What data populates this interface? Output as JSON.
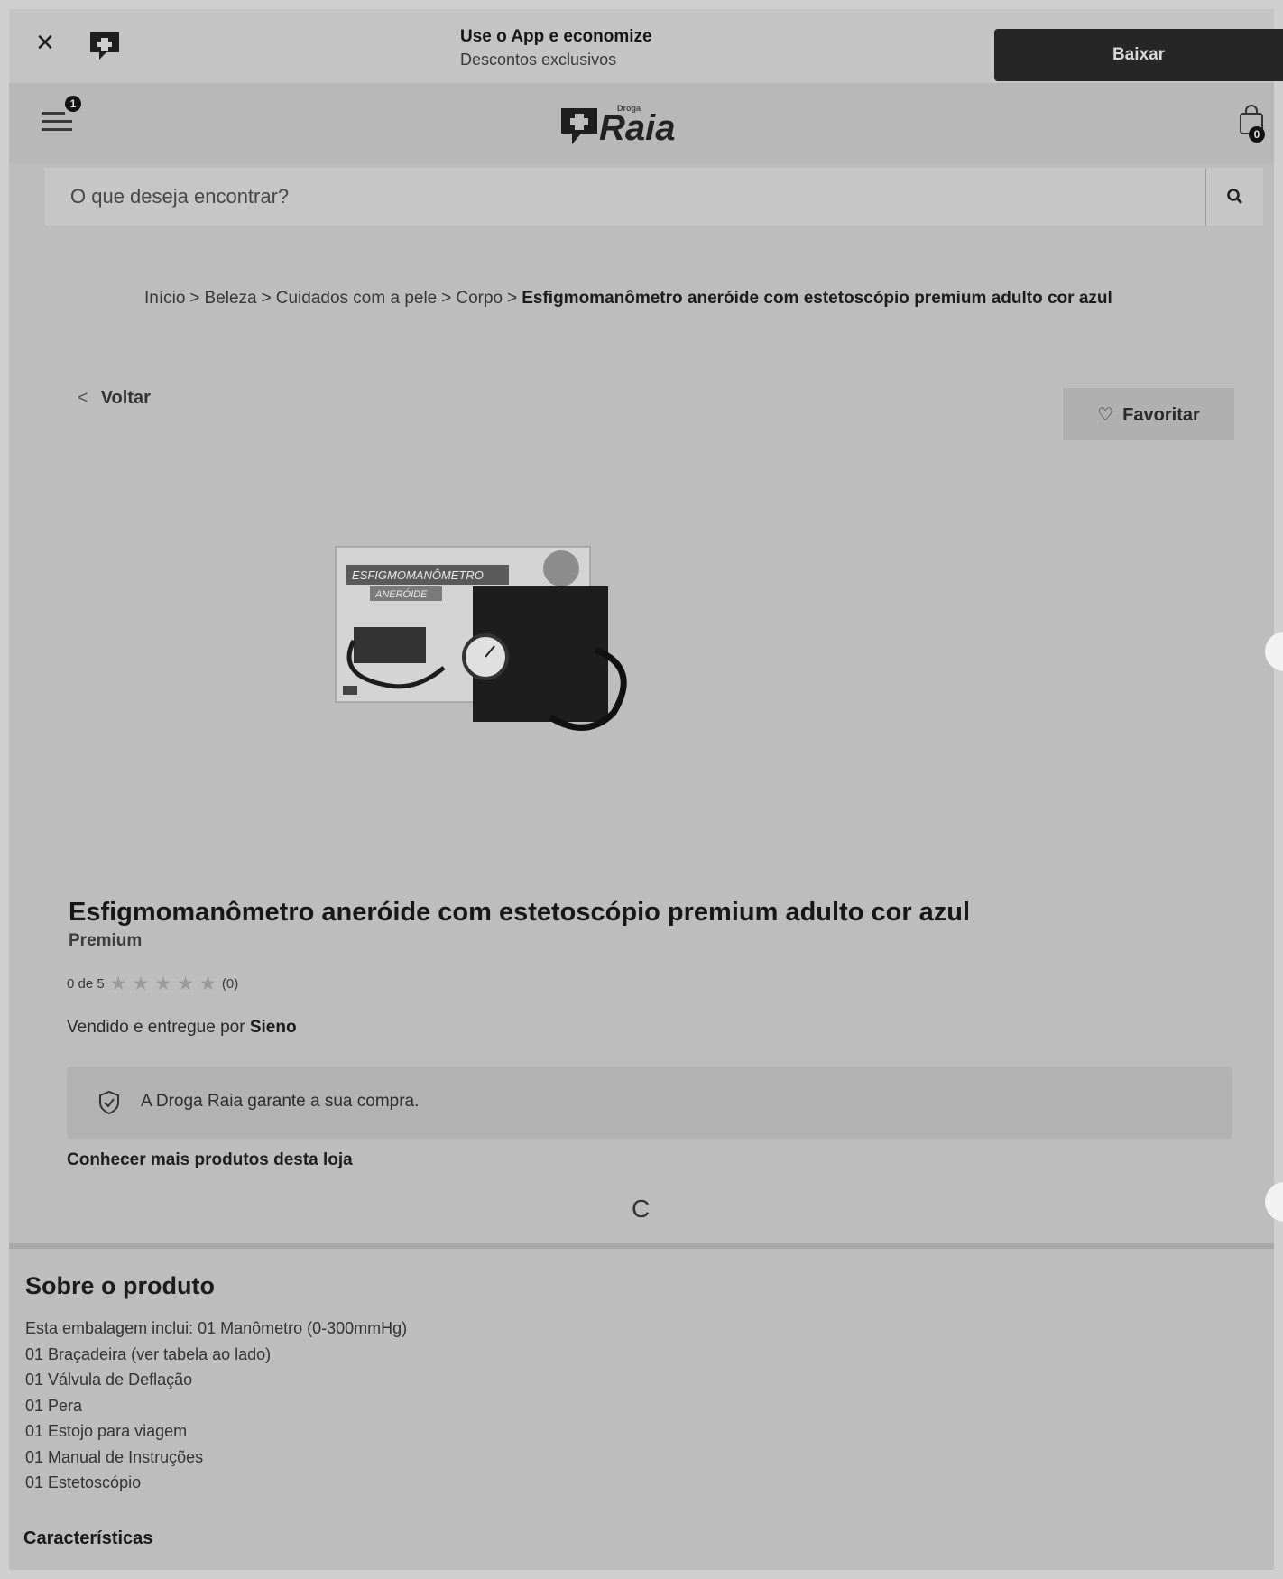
{
  "banner": {
    "title": "Use o App e economize",
    "subtitle": "Descontos exclusivos",
    "download_label": "Baixar"
  },
  "header": {
    "menu_badge": "1",
    "logo_small": "Droga",
    "logo_word": "Raia",
    "cart_count": "0"
  },
  "search": {
    "placeholder": "O que deseja encontrar?"
  },
  "breadcrumb": {
    "items": [
      "Início",
      "Beleza",
      "Cuidados com a pele",
      "Corpo"
    ],
    "separator": ">",
    "current": "Esfigmomanômetro aneróide com estetoscópio premium adulto cor azul"
  },
  "nav": {
    "back_label": "Voltar",
    "favorite_label": "Favoritar"
  },
  "product": {
    "image_text_top": "ESFIGMOMANÔMETRO",
    "image_text_sub": "ANERÓIDE",
    "title": "Esfigmomanômetro aneróide com estetoscópio premium adulto cor azul",
    "brand": "Premium",
    "rating_text": "0 de 5",
    "rating_value": 0,
    "rating_max": 5,
    "review_count": "(0)",
    "sold_prefix": "Vendido e entregue por",
    "seller": "Sieno",
    "guarantee": "A Droga Raia garante a sua compra.",
    "store_link": "Conhecer mais produtos desta loja",
    "loading": "C"
  },
  "about": {
    "title": "Sobre o produto",
    "lines": [
      "Esta embalagem inclui: 01 Manômetro (0-300mmHg)",
      "01 Braçadeira (ver tabela ao lado)",
      "01 Válvula de Deflação",
      "01 Pera",
      "01 Estojo para viagem",
      "01 Manual de Instruções",
      "01 Estetoscópio"
    ],
    "characteristics_title": "Características"
  }
}
